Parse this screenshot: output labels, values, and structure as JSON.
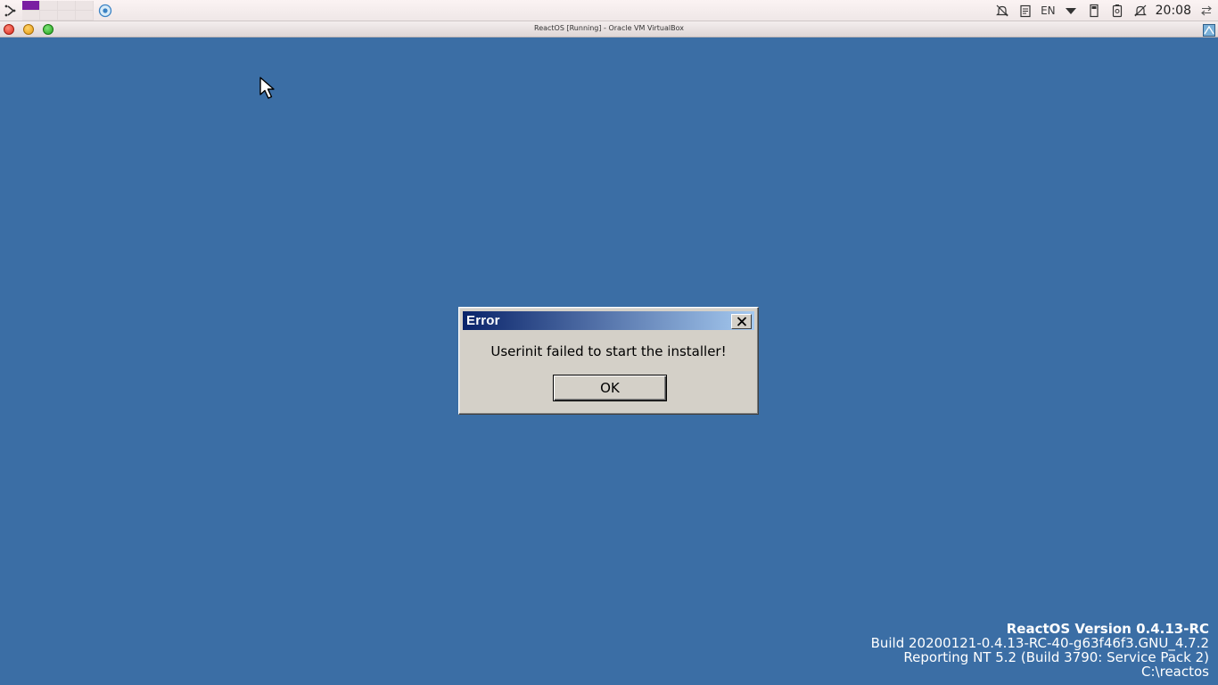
{
  "host_panel": {
    "language": "EN",
    "clock": "20:08",
    "icons": [
      "launcher-icon",
      "virtualbox-icon",
      "notifications-muted-icon",
      "clipboard-icon",
      "dropdown-triangle-icon",
      "usb-drive-icon",
      "battery-icon",
      "bell-muted-icon",
      "network-arrows-icon"
    ],
    "colors": {
      "active_workspace": "#7a1fa2"
    }
  },
  "vm_window": {
    "title": "ReactOS [Running] - Oracle VM VirtualBox",
    "buttons": [
      "close",
      "minimize",
      "maximize"
    ]
  },
  "guest": {
    "desktop_color": "#3b6ea5",
    "dialog": {
      "title": "Error",
      "message": "Userinit failed to start the installer!",
      "ok_label": "OK"
    },
    "version_info": {
      "line1": "ReactOS Version 0.4.13-RC",
      "line2": "Build 20200121-0.4.13-RC-40-g63f46f3.GNU_4.7.2",
      "line3": "Reporting NT 5.2 (Build 3790: Service Pack 2)",
      "line4": "C:\\reactos"
    }
  }
}
